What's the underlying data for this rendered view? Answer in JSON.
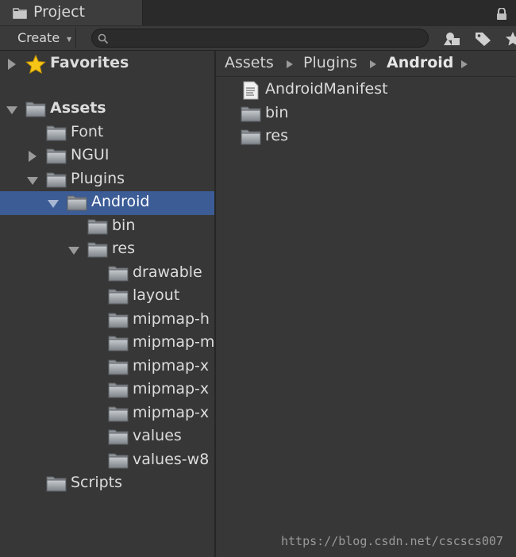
{
  "window": {
    "tab_title": "Project"
  },
  "toolbar": {
    "create_label": "Create",
    "search_value": ""
  },
  "tree": [
    {
      "label": "Favorites",
      "depth": 0,
      "expander": "collapsed",
      "icon": "star",
      "bold": true
    },
    {
      "label": "Assets",
      "depth": 0,
      "expander": "expanded",
      "icon": "folder",
      "bold": true
    },
    {
      "label": "Font",
      "depth": 1,
      "expander": "none",
      "icon": "folder"
    },
    {
      "label": "NGUI",
      "depth": 1,
      "expander": "collapsed",
      "icon": "folder"
    },
    {
      "label": "Plugins",
      "depth": 1,
      "expander": "expanded",
      "icon": "folder"
    },
    {
      "label": "Android",
      "depth": 2,
      "expander": "expanded",
      "icon": "folder",
      "selected": true
    },
    {
      "label": "bin",
      "depth": 3,
      "expander": "none",
      "icon": "folder"
    },
    {
      "label": "res",
      "depth": 3,
      "expander": "expanded",
      "icon": "folder"
    },
    {
      "label": "drawable",
      "depth": 4,
      "expander": "none",
      "icon": "folder"
    },
    {
      "label": "layout",
      "depth": 4,
      "expander": "none",
      "icon": "folder"
    },
    {
      "label": "mipmap-h",
      "depth": 4,
      "expander": "none",
      "icon": "folder"
    },
    {
      "label": "mipmap-m",
      "depth": 4,
      "expander": "none",
      "icon": "folder"
    },
    {
      "label": "mipmap-x",
      "depth": 4,
      "expander": "none",
      "icon": "folder"
    },
    {
      "label": "mipmap-x",
      "depth": 4,
      "expander": "none",
      "icon": "folder"
    },
    {
      "label": "mipmap-x",
      "depth": 4,
      "expander": "none",
      "icon": "folder"
    },
    {
      "label": "values",
      "depth": 4,
      "expander": "none",
      "icon": "folder"
    },
    {
      "label": "values-w8",
      "depth": 4,
      "expander": "none",
      "icon": "folder"
    },
    {
      "label": "Scripts",
      "depth": 1,
      "expander": "none",
      "icon": "folder"
    }
  ],
  "breadcrumb": [
    "Assets",
    "Plugins",
    "Android"
  ],
  "assets": [
    {
      "label": "AndroidManifest",
      "icon": "document"
    },
    {
      "label": "bin",
      "icon": "folder"
    },
    {
      "label": "res",
      "icon": "folder"
    }
  ],
  "watermark": "https://blog.csdn.net/cscscs007",
  "colors": {
    "selection": "#3c5c96",
    "background": "#373737",
    "text": "#dcdcdc",
    "star": "#f5c518"
  }
}
